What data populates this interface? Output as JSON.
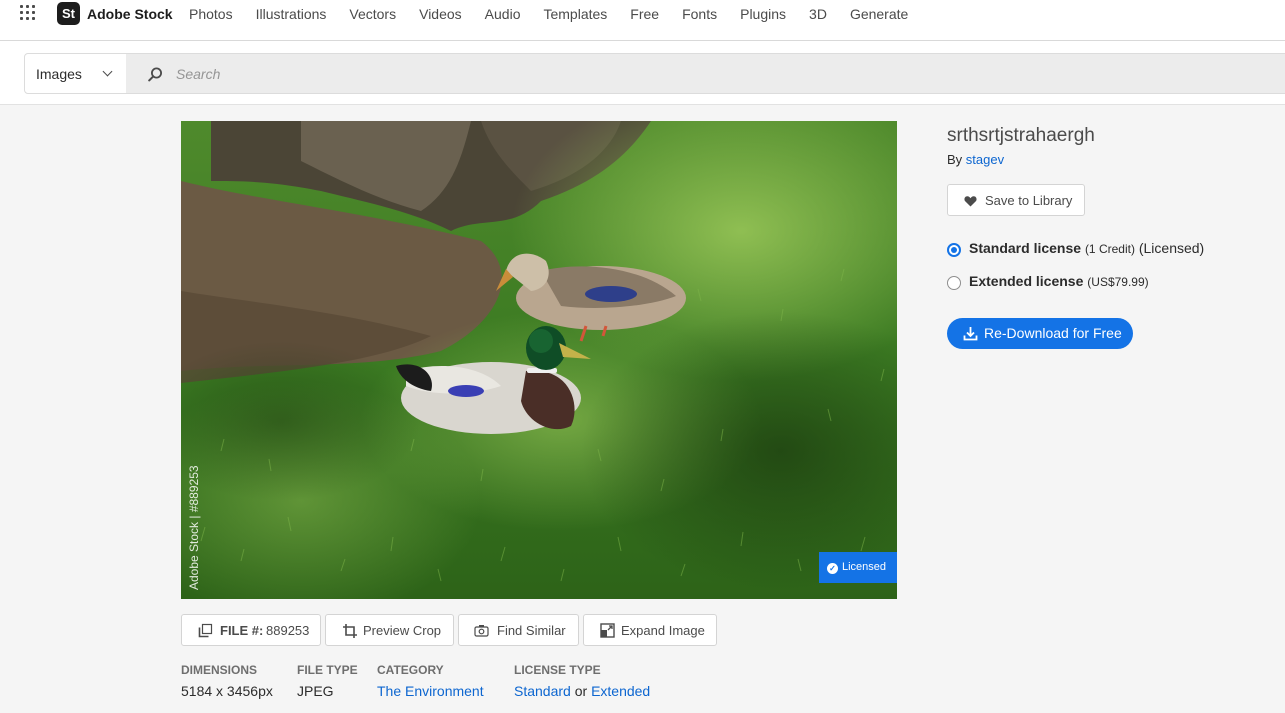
{
  "app": {
    "logo_mark": "St",
    "logo_text": "Adobe Stock",
    "nav": [
      "Photos",
      "Illustrations",
      "Vectors",
      "Videos",
      "Audio",
      "Templates",
      "Free",
      "Fonts",
      "Plugins",
      "3D",
      "Generate"
    ]
  },
  "search": {
    "scope": "Images",
    "placeholder": "Search"
  },
  "image": {
    "watermark": "Adobe Stock | #889253",
    "badge": "Licensed"
  },
  "tools": {
    "file_label": "FILE #:",
    "file_number": "889253",
    "preview_crop": "Preview Crop",
    "find_similar": "Find Similar",
    "expand_image": "Expand Image"
  },
  "meta": {
    "dimensions_label": "DIMENSIONS",
    "dimensions": "5184 x 3456px",
    "filetype_label": "FILE TYPE",
    "filetype": "JPEG",
    "category_label": "CATEGORY",
    "category": "The Environment",
    "licensetype_label": "LICENSE TYPE",
    "license_standard": "Standard",
    "license_or": "or",
    "license_extended": "Extended"
  },
  "asset": {
    "title": "srthsrtjstrahaergh",
    "by": "By",
    "author": "stagev",
    "save_to_library": "Save to Library"
  },
  "licenses": {
    "standard_name": "Standard license",
    "standard_detail": "(1 Credit)",
    "standard_status": "(Licensed)",
    "standard_selected": true,
    "extended_name": "Extended license",
    "extended_price": "(US$79.99)"
  },
  "download": {
    "label": "Re-Download for Free"
  },
  "colors": {
    "accent": "#1473e6",
    "link": "#0d66d0"
  }
}
